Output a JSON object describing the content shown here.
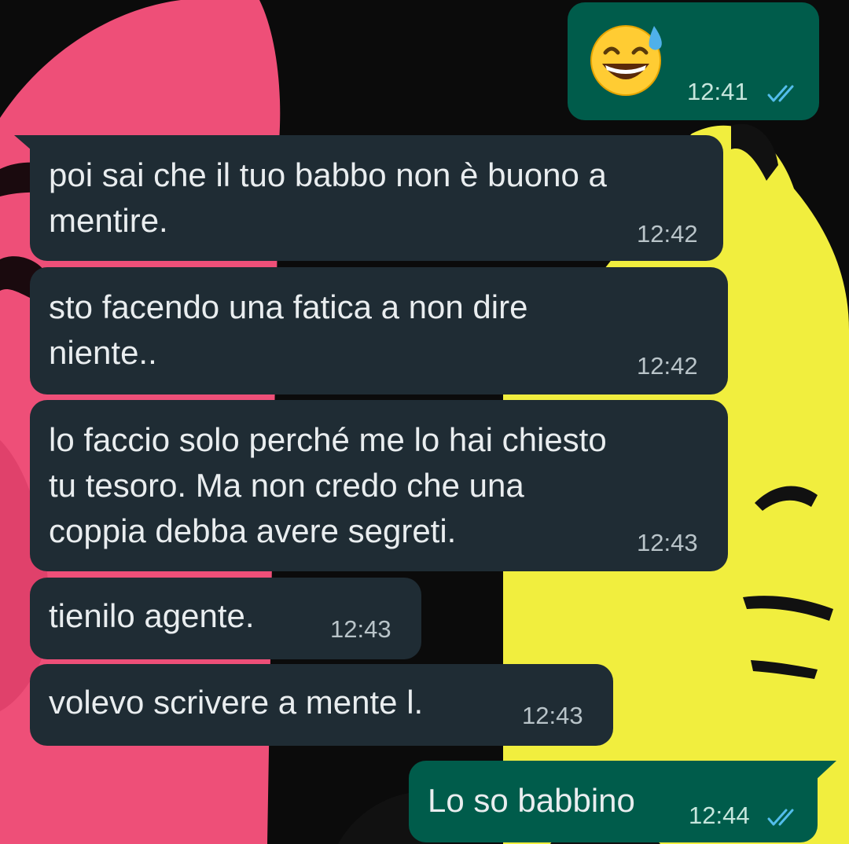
{
  "chat": {
    "messages": [
      {
        "direction": "out",
        "type": "emoji",
        "emoji_name": "grinning-face-with-sweat-emoji",
        "time": "12:41",
        "status": "read-double-check-icon"
      },
      {
        "direction": "in",
        "text": "poi sai che il tuo babbo non è buono a\nmentire.",
        "time": "12:42"
      },
      {
        "direction": "in",
        "text": "sto facendo una fatica a non dire\nniente..",
        "time": "12:42"
      },
      {
        "direction": "in",
        "text": "lo faccio solo perché me lo hai chiesto\ntu tesoro. Ma non credo che una\ncoppia debba avere segreti.",
        "time": "12:43"
      },
      {
        "direction": "in",
        "text": "tienilo agente.",
        "time": "12:43"
      },
      {
        "direction": "in",
        "text": "volevo scrivere a mente l.",
        "time": "12:43"
      },
      {
        "direction": "out",
        "text": "Lo so babbino",
        "time": "12:44",
        "status": "read-double-check-icon"
      }
    ]
  },
  "colors": {
    "incoming_bubble": "#1f2c34",
    "outgoing_bubble": "#005c4b",
    "read_tick": "#53bdeb",
    "wallpaper_pink": "#ee4f78",
    "wallpaper_yellow": "#f1ee3e"
  }
}
